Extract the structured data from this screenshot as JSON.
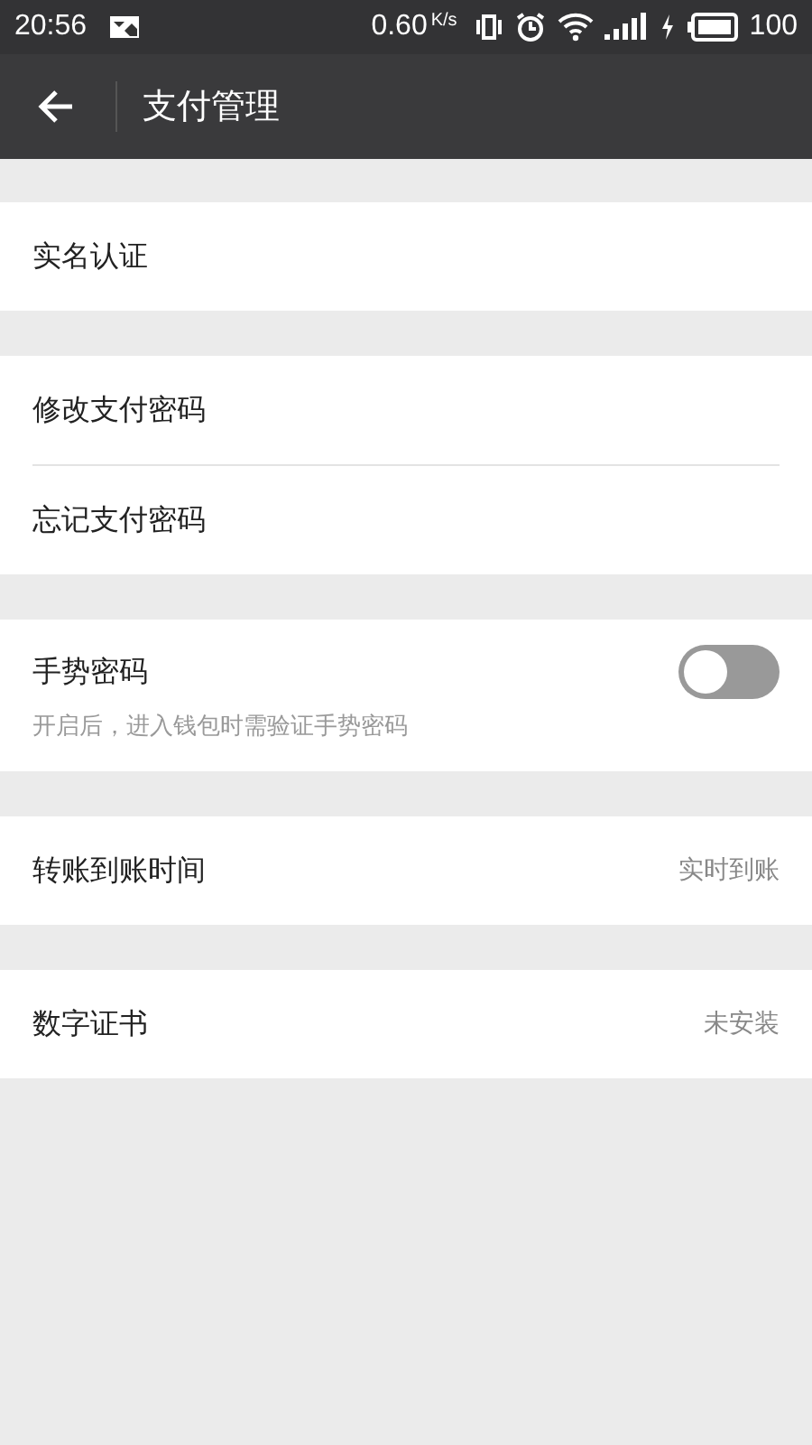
{
  "status_bar": {
    "time": "20:56",
    "speed": "0.60",
    "speed_unit": "K/s",
    "battery": "100"
  },
  "toolbar": {
    "title": "支付管理"
  },
  "groups": [
    {
      "items": [
        {
          "kind": "link",
          "label": "实名认证"
        }
      ]
    },
    {
      "items": [
        {
          "kind": "link",
          "label": "修改支付密码"
        },
        {
          "kind": "link",
          "label": "忘记支付密码"
        }
      ]
    },
    {
      "items": [
        {
          "kind": "toggle",
          "label": "手势密码",
          "on": false,
          "hint": "开启后，进入钱包时需验证手势密码"
        }
      ]
    },
    {
      "items": [
        {
          "kind": "value",
          "label": "转账到账时间",
          "value": "实时到账"
        }
      ]
    },
    {
      "items": [
        {
          "kind": "value",
          "label": "数字证书",
          "value": "未安装"
        }
      ]
    }
  ]
}
